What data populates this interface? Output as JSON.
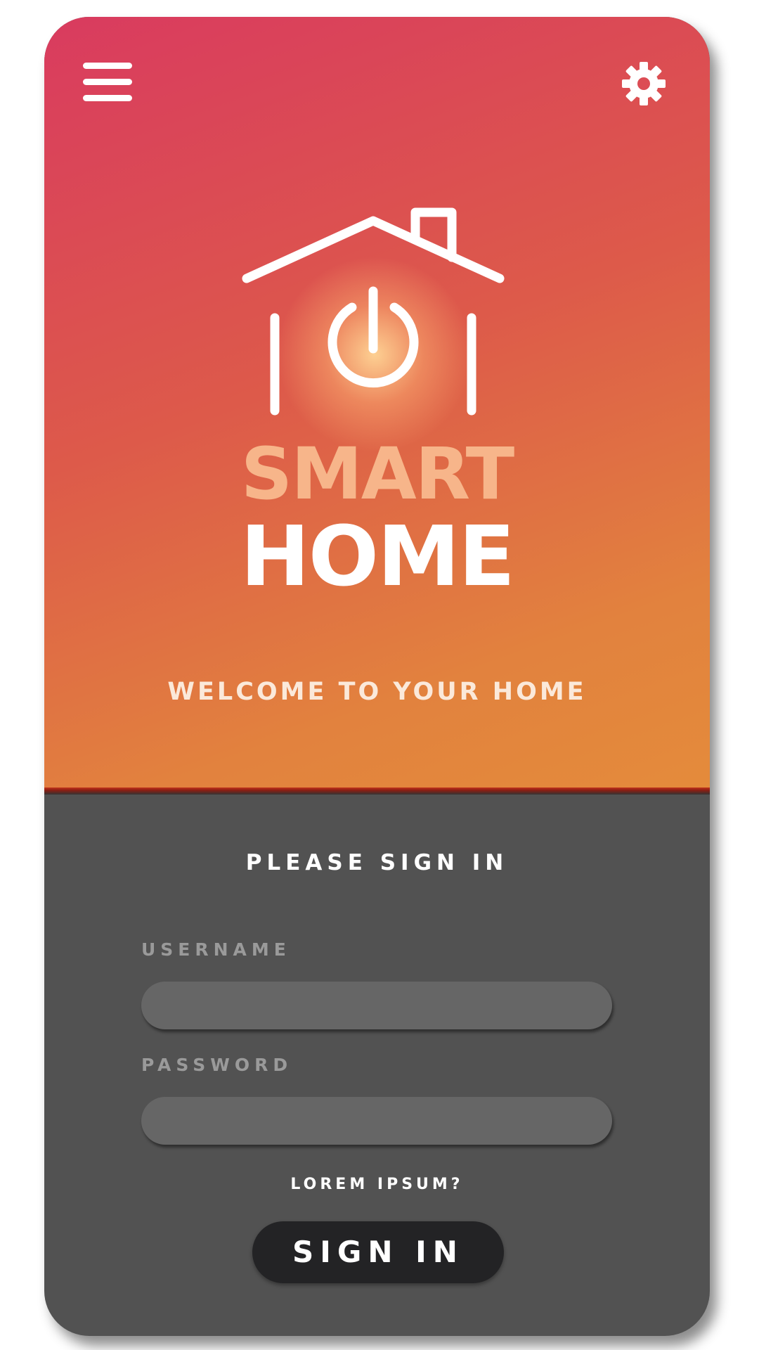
{
  "header": {
    "menu_icon": "menu-icon",
    "settings_icon": "gear-icon"
  },
  "logo": {
    "icon": "house-power-icon",
    "line1": "SMART",
    "line2": "HOME"
  },
  "welcome_text": "WELCOME TO YOUR HOME",
  "login": {
    "title": "PLEASE SIGN IN",
    "username_label": "USERNAME",
    "username_value": "",
    "password_label": "PASSWORD",
    "password_value": "",
    "forgot_link": "LOREM IPSUM?",
    "submit_label": "SIGN IN"
  },
  "colors": {
    "gradient_start": "#d93b5f",
    "gradient_end": "#e48b3b",
    "logo_accent": "#f7b58a",
    "panel_bg": "#525252",
    "input_bg": "#666666",
    "button_bg": "#232325"
  }
}
